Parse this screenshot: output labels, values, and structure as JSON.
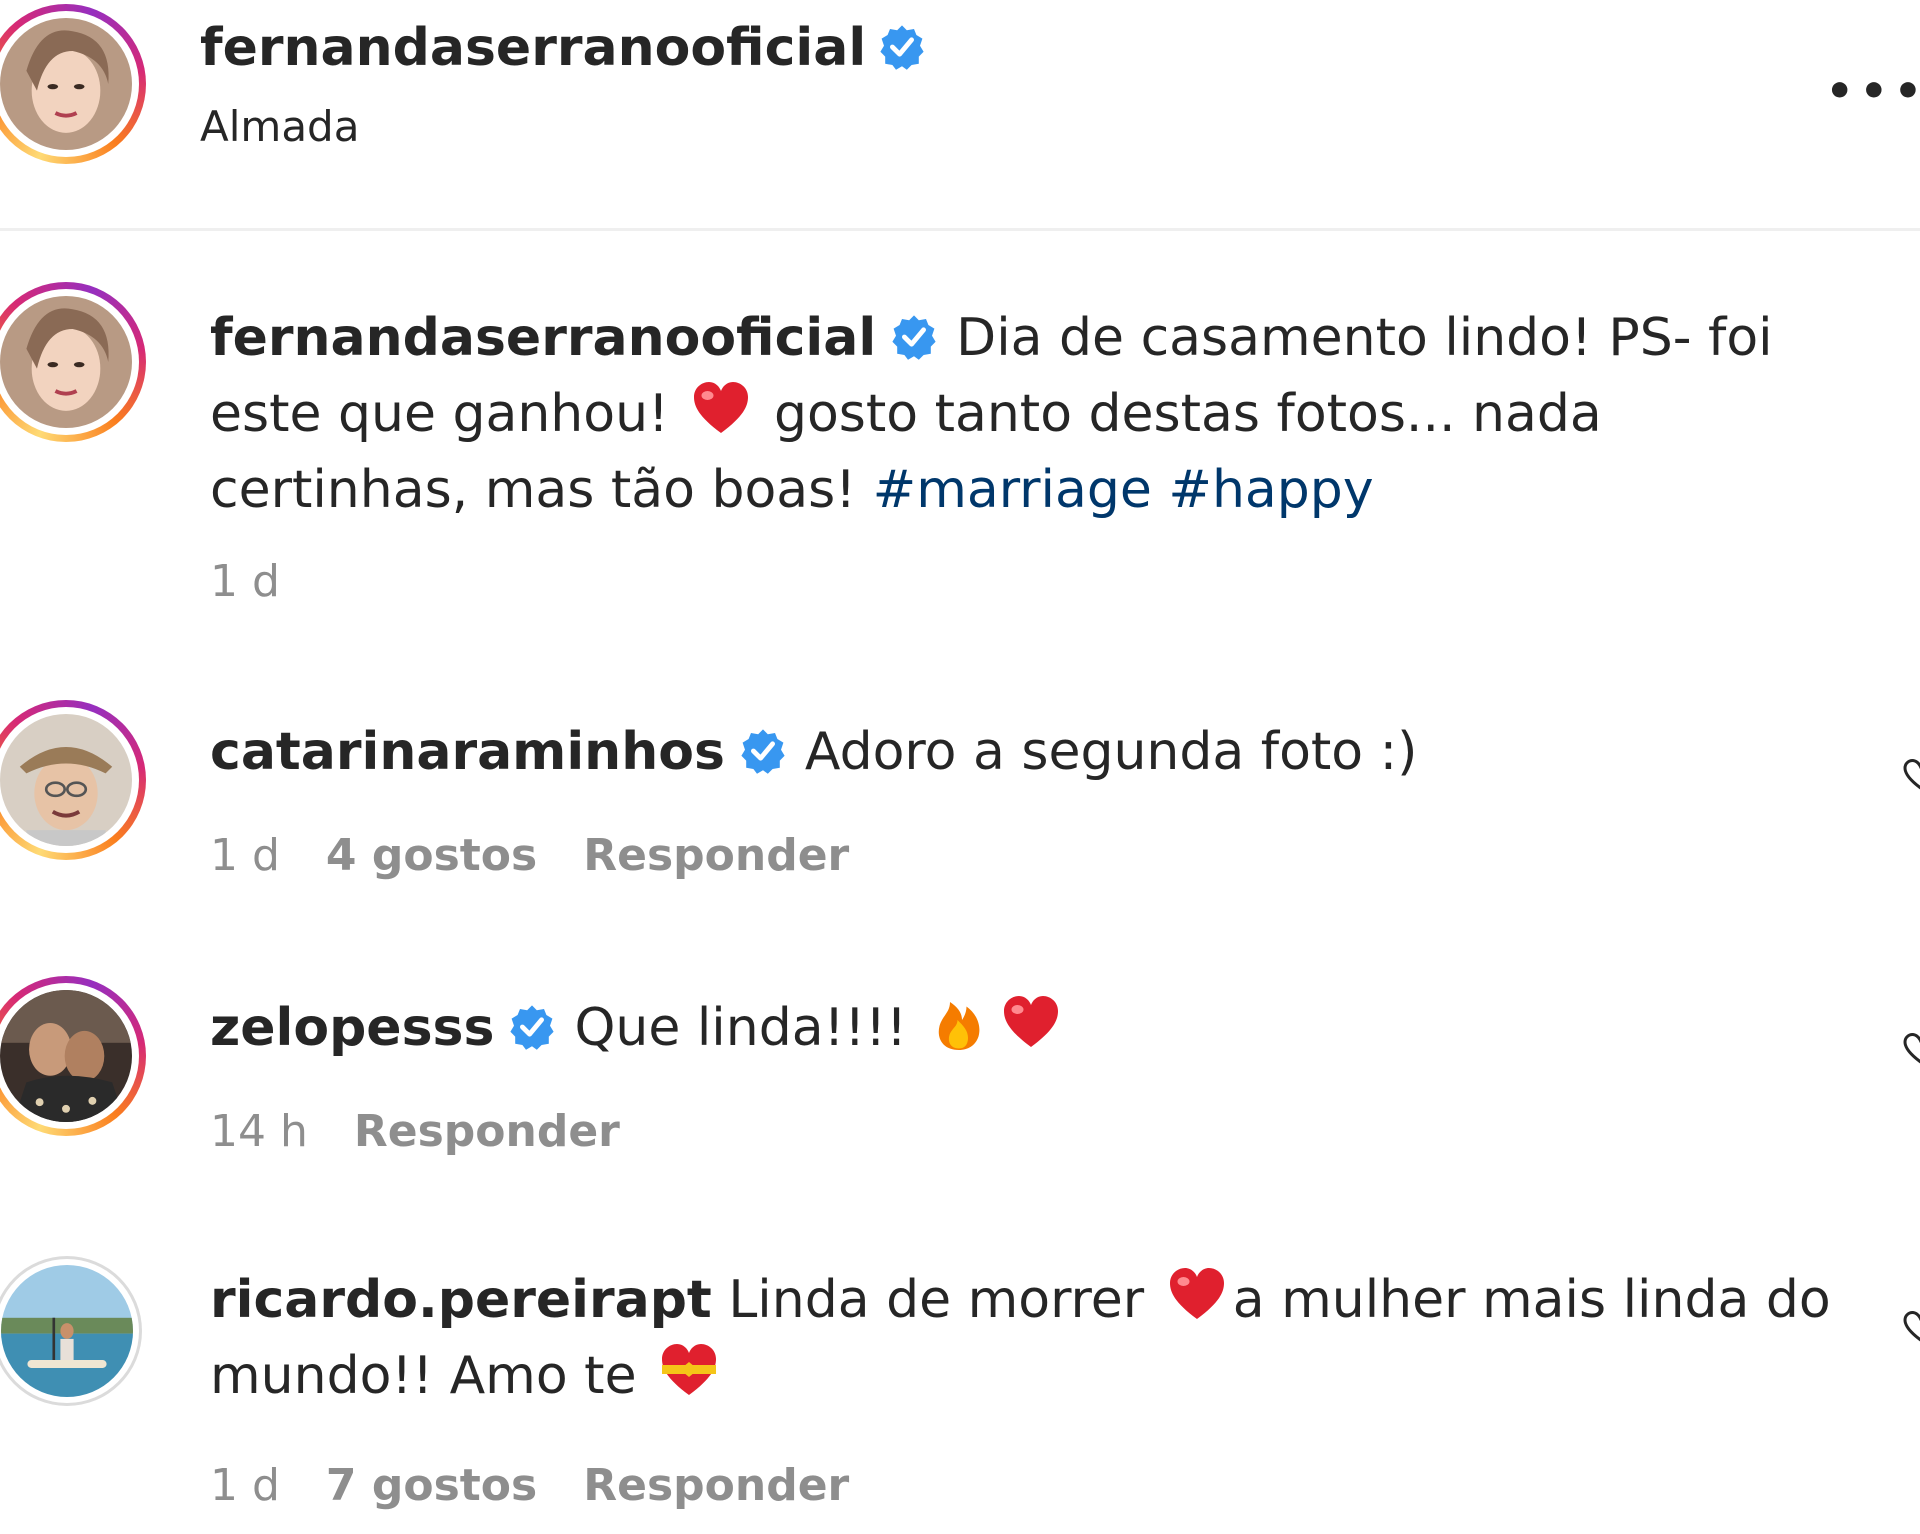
{
  "header": {
    "username": "fernandaserranooficial",
    "location": "Almada",
    "more_label": "•••"
  },
  "caption": {
    "username": "fernandaserranooficial",
    "text_1": "Dia de casamento lindo! PS- foi este que ganhou!",
    "text_2": "gosto tanto destas fotos... nada certinhas, mas tão boas!",
    "hashtag_1": "#marriage",
    "hashtag_2": "#happy",
    "time": "1 d"
  },
  "comments": [
    {
      "username": "catarinaraminhos",
      "text": "Adoro a segunda foto :)",
      "time": "1 d",
      "likes": "4 gostos",
      "reply": "Responder"
    },
    {
      "username": "zelopesss",
      "text": "Que linda!!!!",
      "time": "14 h",
      "reply": "Responder"
    },
    {
      "username": "ricardo.pereirapt",
      "text_1": "Linda de morrer",
      "text_2": "a mulher mais linda do mundo!! Amo te",
      "time": "1 d",
      "likes": "7 gostos",
      "reply": "Responder"
    }
  ],
  "colors": {
    "verified": "#3897f0",
    "hashtag": "#00376b",
    "muted": "#8e8e8e",
    "heart_emoji": "#e0202e"
  },
  "icons": {
    "verified": "verified-badge-icon",
    "heart": "red-heart-emoji",
    "fire": "fire-emoji",
    "like": "heart-outline-icon"
  }
}
